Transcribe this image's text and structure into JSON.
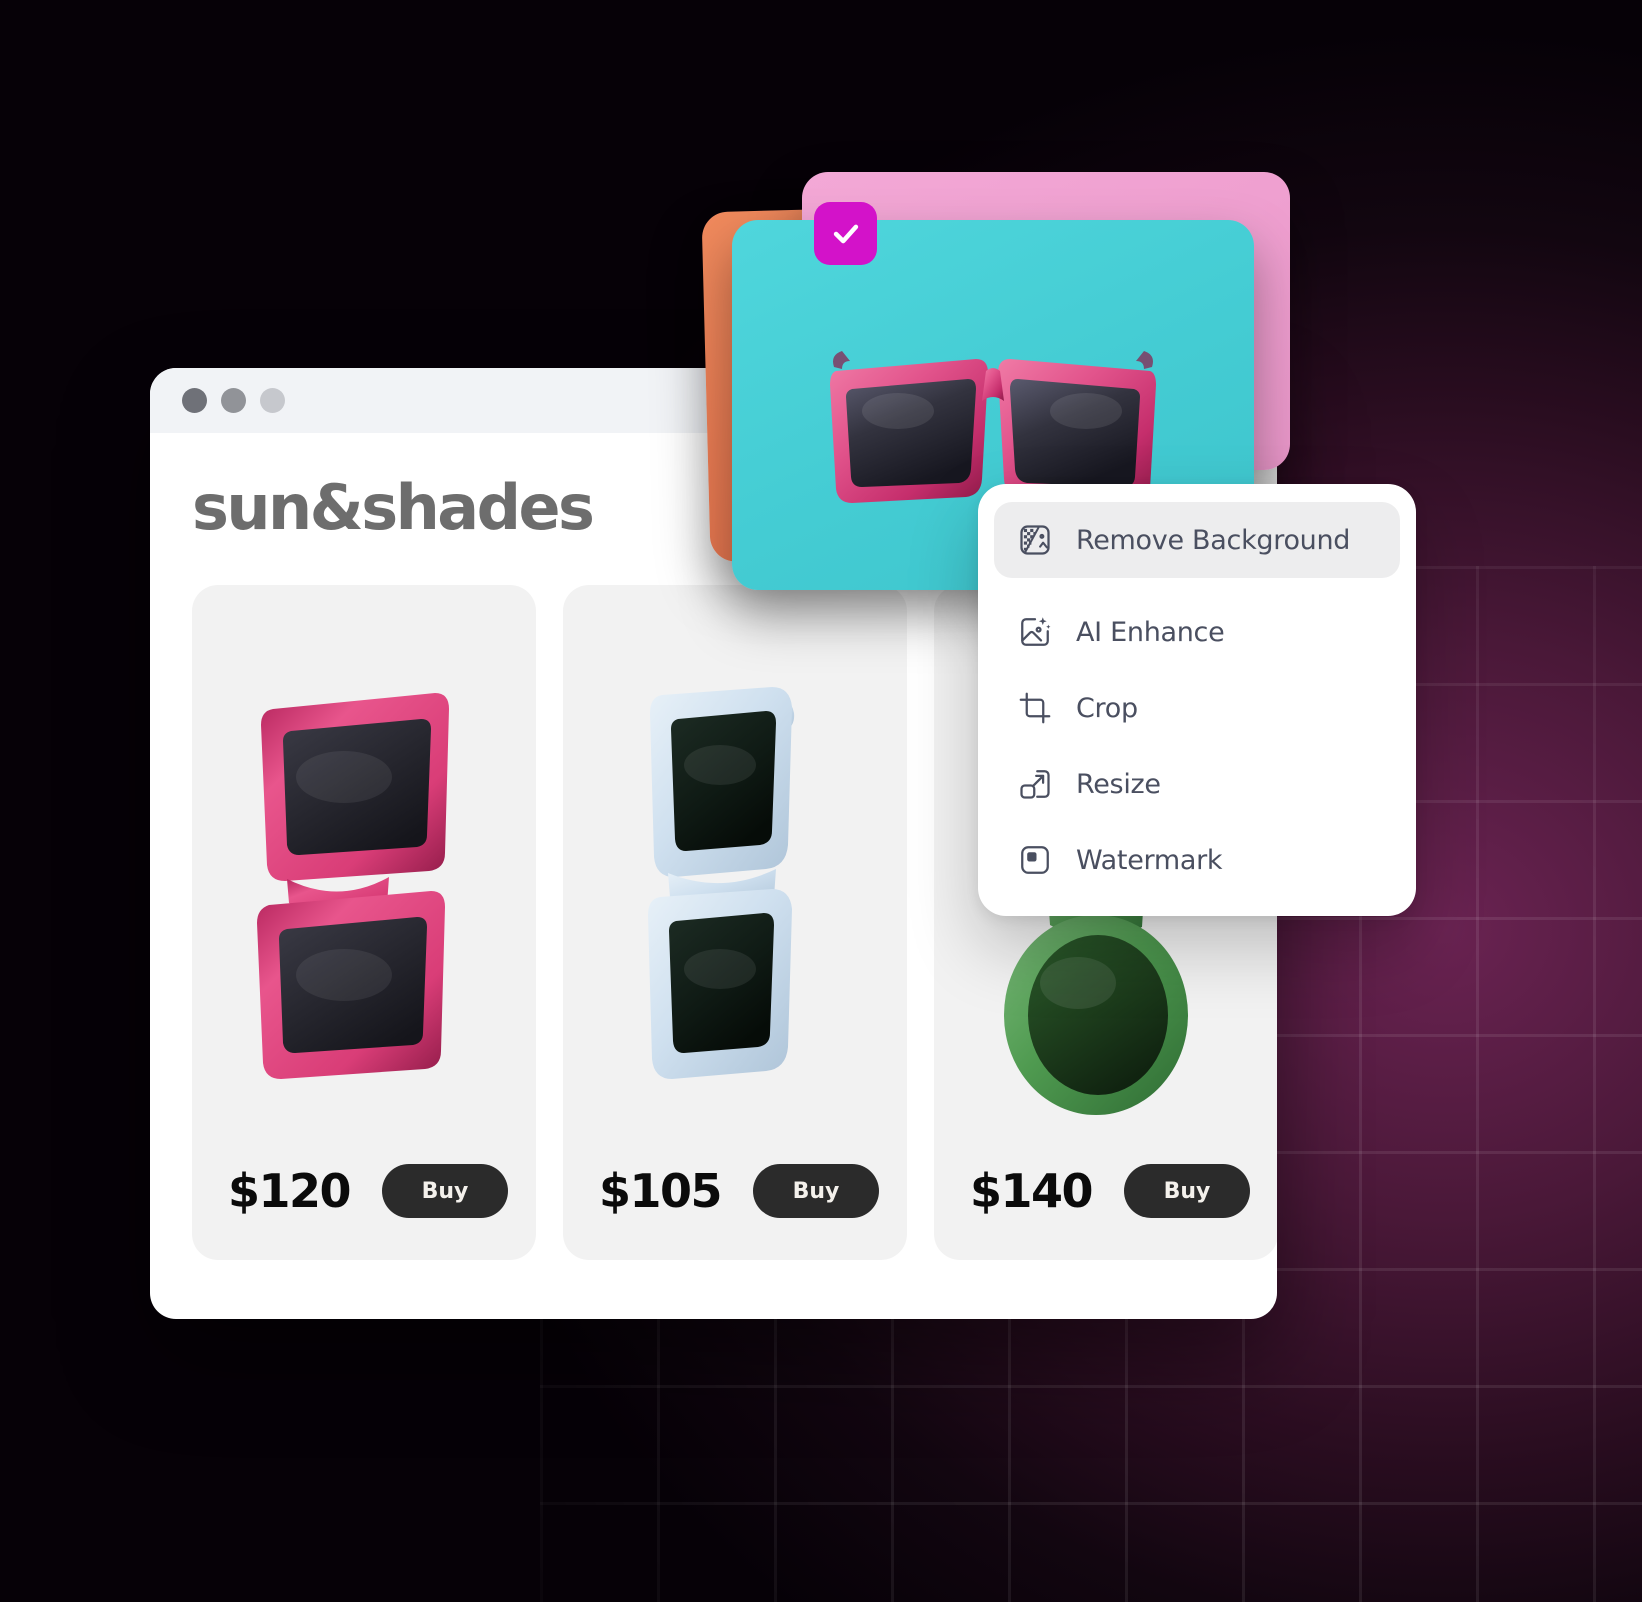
{
  "background": {
    "base_color": "#050106",
    "accent_color": "#6a2352",
    "grid": "visible"
  },
  "browser": {
    "traffic_lights": [
      {
        "name": "close-dot",
        "color": "#6f7178"
      },
      {
        "name": "minimize-dot",
        "color": "#919398"
      },
      {
        "name": "maximize-dot",
        "color": "#c6c8cd"
      }
    ],
    "brand": "sun&shades",
    "products": [
      {
        "name": "pink-square-sunglasses",
        "price": "$120",
        "buy_label": "Buy",
        "frame_color": "#e8558c",
        "lens_color": "#2c2c34"
      },
      {
        "name": "light-blue-sunglasses",
        "price": "$105",
        "buy_label": "Buy",
        "frame_color": "#cfe0ef",
        "lens_color": "#101a16"
      },
      {
        "name": "green-round-sunglasses",
        "price": "$140",
        "buy_label": "Buy",
        "frame_color": "#4f9a50",
        "lens_color": "#1d3d1c"
      }
    ]
  },
  "card_stack": {
    "cards": [
      {
        "name": "coral-image-card",
        "color": "#e87a52"
      },
      {
        "name": "pink-image-card",
        "color": "#efa0d0"
      },
      {
        "name": "teal-image-card",
        "color": "#45cdd4"
      }
    ],
    "selected_badge_color": "#d312c9",
    "badge_icon": "check-icon"
  },
  "context_menu": {
    "items": [
      {
        "icon": "remove-background-icon",
        "label": "Remove Background",
        "active": true
      },
      {
        "icon": "ai-enhance-icon",
        "label": "AI Enhance",
        "active": false
      },
      {
        "icon": "crop-icon",
        "label": "Crop",
        "active": false
      },
      {
        "icon": "resize-icon",
        "label": "Resize",
        "active": false
      },
      {
        "icon": "watermark-icon",
        "label": "Watermark",
        "active": false
      }
    ],
    "text_color": "#4a4f60",
    "active_bg": "#ededee"
  }
}
